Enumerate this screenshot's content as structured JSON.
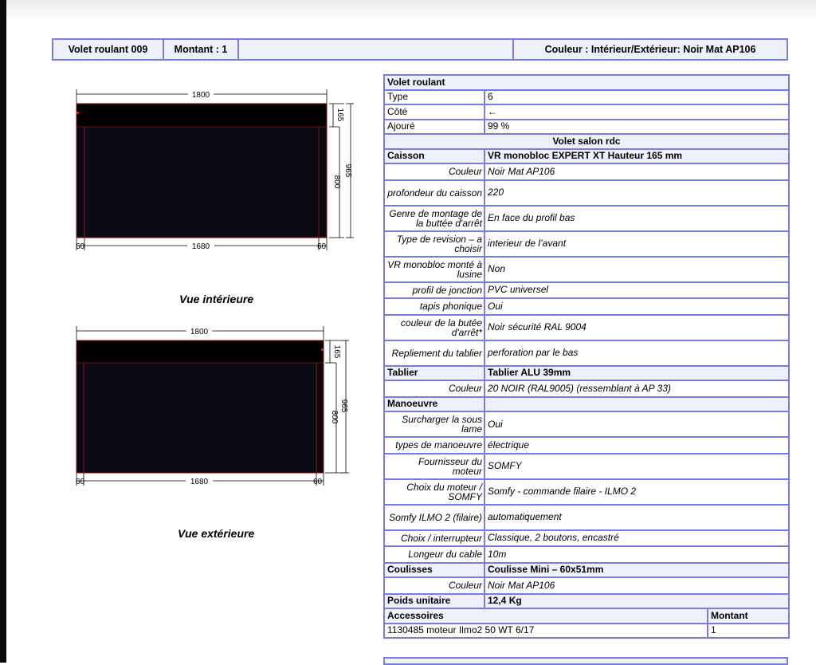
{
  "header": {
    "product": "Volet roulant 009",
    "quantity": "Montant : 1",
    "color": "Couleur : Intérieur/Extérieur: Noir Mat AP106"
  },
  "views": [
    {
      "caption": "Vue intérieure",
      "dim_top": "1800",
      "dim_bottom": "1680",
      "dim_left": "60",
      "dim_right": "60",
      "dim_caisson": "165",
      "dim_inner": "800",
      "dim_total": "965"
    },
    {
      "caption": "Vue extérieure",
      "dim_top": "1800",
      "dim_bottom": "1680",
      "dim_left": "60",
      "dim_right": "60",
      "dim_caisson": "165",
      "dim_inner": "800",
      "dim_total": "965"
    }
  ],
  "table": {
    "title": "Volet roulant",
    "general": [
      {
        "label": "Type",
        "value": "6"
      },
      {
        "label": "Côté",
        "value": "←"
      },
      {
        "label": "Ajouré",
        "value": "99 %"
      }
    ],
    "subtitle": "Volet salon rdc",
    "caisson": {
      "label": "Caisson",
      "value": "VR monobloc EXPERT XT Hauteur 165 mm",
      "rows": [
        {
          "label": "Couleur",
          "value": "Noir Mat AP106"
        },
        {
          "label": "profondeur du caisson",
          "value": "220"
        },
        {
          "label": "Genre de montage de la buttée d'arrêt",
          "value": "En face du profil bas"
        },
        {
          "label": "Type de revision – a choisir",
          "value": "interieur de l’avant"
        },
        {
          "label": "VR monobloc monté à lusine",
          "value": "Non"
        },
        {
          "label": "profil de jonction",
          "value": "PVC universel"
        },
        {
          "label": "tapis phonique",
          "value": "Oui"
        },
        {
          "label": "couleur de la butée d'arrêt*",
          "value": "Noir sécurité RAL 9004"
        },
        {
          "label": "Repliement du tablier",
          "value": "perforation par le bas"
        }
      ]
    },
    "tablier": {
      "label": "Tablier",
      "value": "Tablier ALU 39mm",
      "rows": [
        {
          "label": "Couleur",
          "value": "20 NOIR (RAL9005) (ressemblant à AP 33)"
        }
      ]
    },
    "manoeuvre": {
      "label": "Manoeuvre",
      "value": "",
      "rows": [
        {
          "label": "Surcharger la sous lame",
          "value": "Oui"
        },
        {
          "label": "types de manoeuvre",
          "value": "électrique"
        },
        {
          "label": "Fournisseur du moteur",
          "value": "SOMFY"
        },
        {
          "label": "Choix du moteur / SOMFY",
          "value": "Somfy - commande filaire - ILMO 2"
        },
        {
          "label": "Somfy ILMO 2 (filaire)",
          "value": "automatiquement"
        },
        {
          "label": "Choix / interrupteur",
          "value": "Classique, 2 boutons, encastré"
        },
        {
          "label": "Longeur du cable",
          "value": "10m"
        }
      ]
    },
    "coulisses": {
      "label": "Coulisses",
      "value": "Coulisse Mini – 60x51mm",
      "rows": [
        {
          "label": "Couleur",
          "value": "Noir Mat AP106"
        }
      ]
    },
    "poids": {
      "label": "Poids unitaire",
      "value": "12,4 Kg"
    },
    "accessoires": {
      "label": "Accessoires",
      "qty_header": "Montant",
      "items": [
        {
          "name": "1130485 moteur Ilmo2 50 WT 6/17",
          "qty": "1"
        }
      ]
    }
  }
}
